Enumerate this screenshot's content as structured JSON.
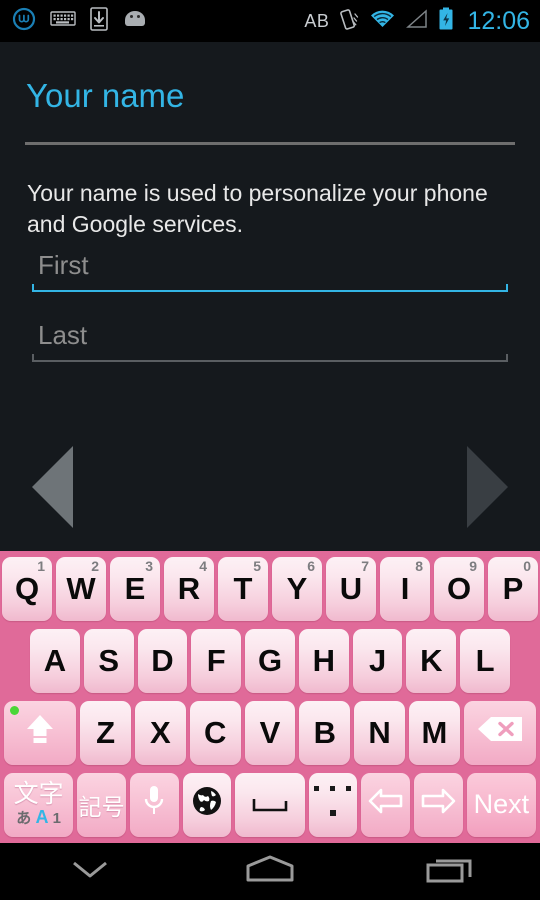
{
  "statusbar": {
    "time": "12:06",
    "ab_label": "AB",
    "left_icons": [
      "whatsapp-logo-icon",
      "keyboard-icon",
      "download-to-device-icon",
      "android-robot-icon"
    ],
    "right_icons": [
      "ab-text-icon",
      "vibrate-icon",
      "wifi-icon",
      "cell-signal-icon",
      "battery-charging-icon"
    ],
    "accent_color": "#33b5e5"
  },
  "setup": {
    "title": "Your name",
    "description": "Your name is used to personalize your phone and Google services.",
    "fields": [
      {
        "name": "first",
        "placeholder": "First",
        "value": "",
        "focused": true,
        "underline_color": "#33b5e5"
      },
      {
        "name": "last",
        "placeholder": "Last",
        "value": "",
        "focused": false,
        "underline_color": "#5a5e62"
      }
    ],
    "back_button": "back-arrow-icon",
    "next_button": "next-arrow-icon"
  },
  "keyboard": {
    "theme_color": "#e06a99",
    "caps_lock_on": true,
    "rows": [
      {
        "name": "row-qwerty",
        "keys": [
          {
            "label": "Q",
            "num": "1"
          },
          {
            "label": "W",
            "num": "2"
          },
          {
            "label": "E",
            "num": "3"
          },
          {
            "label": "R",
            "num": "4"
          },
          {
            "label": "T",
            "num": "5"
          },
          {
            "label": "Y",
            "num": "6"
          },
          {
            "label": "U",
            "num": "7"
          },
          {
            "label": "I",
            "num": "8"
          },
          {
            "label": "O",
            "num": "9"
          },
          {
            "label": "P",
            "num": "0"
          }
        ]
      },
      {
        "name": "row-asdf",
        "keys": [
          {
            "label": "A"
          },
          {
            "label": "S"
          },
          {
            "label": "D"
          },
          {
            "label": "F"
          },
          {
            "label": "G"
          },
          {
            "label": "H"
          },
          {
            "label": "J"
          },
          {
            "label": "K"
          },
          {
            "label": "L"
          }
        ]
      },
      {
        "name": "row-zxcv",
        "keys": [
          {
            "label": "Z"
          },
          {
            "label": "X"
          },
          {
            "label": "C"
          },
          {
            "label": "V"
          },
          {
            "label": "B"
          },
          {
            "label": "N"
          },
          {
            "label": "M"
          }
        ]
      }
    ],
    "shift_key": {
      "icon": "shift-arrow-icon",
      "indicator": "caps-lock-dot"
    },
    "backspace_key": {
      "icon": "backspace-icon"
    },
    "bottom_row": {
      "mode_key": {
        "label": "文字",
        "sub_hiragana": "あ",
        "sub_alpha": "A",
        "sub_num": "1",
        "active": "A"
      },
      "symbol_key": {
        "label": "記号"
      },
      "mic_key": {
        "icon": "microphone-icon"
      },
      "globe_key": {
        "icon": "globe-icon"
      },
      "space_key": {
        "icon": "space-bar-icon"
      },
      "period_key": {
        "icon": "period-ellipsis-icon"
      },
      "left_key": {
        "icon": "arrow-left-icon"
      },
      "right_key": {
        "icon": "arrow-right-icon"
      },
      "next_key": {
        "label": "Next"
      }
    }
  },
  "navbar": {
    "buttons": [
      {
        "name": "hide-keyboard",
        "icon": "chevron-down-icon"
      },
      {
        "name": "home",
        "icon": "home-icon"
      },
      {
        "name": "recents",
        "icon": "recents-icon"
      }
    ]
  }
}
